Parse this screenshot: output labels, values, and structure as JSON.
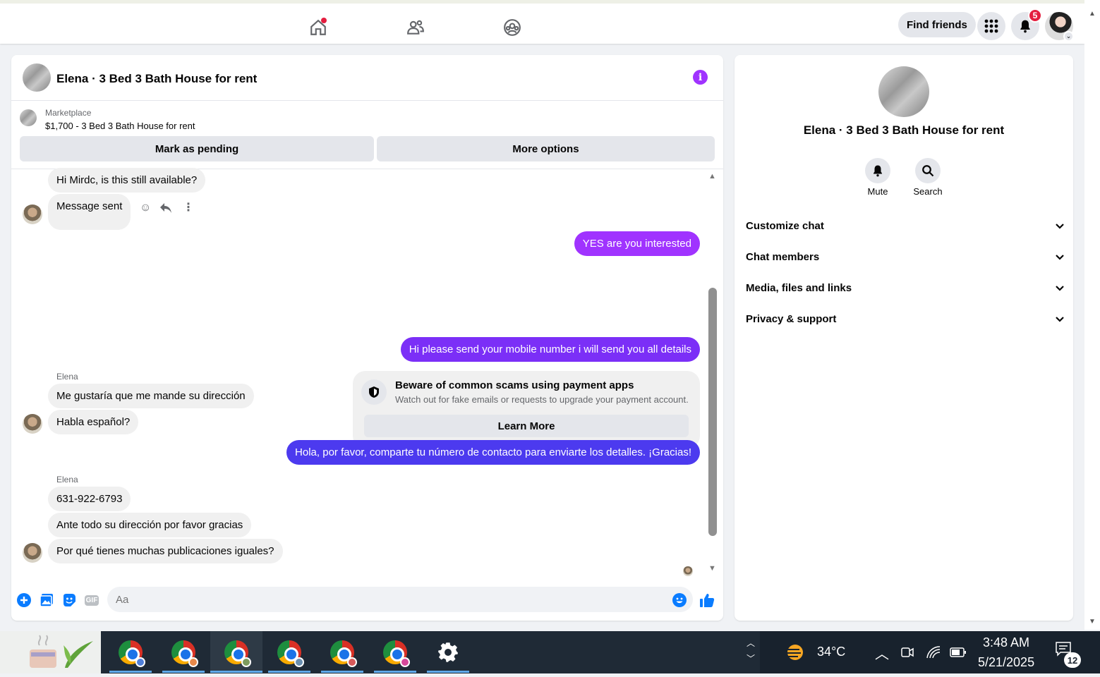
{
  "topbar": {
    "find_friends": "Find friends",
    "notification_count": "5",
    "icons": [
      "home-icon",
      "friends-icon",
      "groups-icon",
      "menu-grid-icon",
      "bell-icon"
    ]
  },
  "chat": {
    "title": "Elena · 3 Bed 3 Bath House for rent",
    "marketplace_label": "Marketplace",
    "listing": "$1,700 - 3 Bed 3 Bath House for rent",
    "mark_pending": "Mark as pending",
    "more_options": "More options",
    "messages": {
      "m1": "Hi Mirdc, is this still available?",
      "m2": "Message sent",
      "m3": "YES are you interested",
      "m4": "Hi please send your mobile number  i will send you all details",
      "sender1": "Elena",
      "m5": "Me gustaría que me mande su dirección",
      "m6": "Habla español?",
      "m7": "Hola, por favor, comparte tu número de contacto para enviarte los detalles. ¡Gracias!",
      "sender2": "Elena",
      "m8": "631-922-6793",
      "m9": "Ante todo su dirección por favor gracias",
      "m10": "Por qué tienes muchas publicaciones iguales?"
    },
    "scam_notice": {
      "title": "Beware of common scams using payment apps",
      "description": "Watch out for fake emails or requests to upgrade your payment account.",
      "button": "Learn More"
    },
    "composer": {
      "placeholder": "Aa",
      "gif_label": "GIF"
    }
  },
  "info_panel": {
    "title": "Elena · 3 Bed 3 Bath House for rent",
    "mute_label": "Mute",
    "search_label": "Search",
    "sections": [
      "Customize chat",
      "Chat members",
      "Media, files and links",
      "Privacy & support"
    ]
  },
  "taskbar": {
    "temperature": "34°C",
    "time": "3:48 AM",
    "date": "5/21/2025",
    "notification_count": "12"
  },
  "colors": {
    "accent_purple": "#a033ff",
    "bubble_gradient": [
      "#a033ff",
      "#7b2ff7",
      "#4c3aef",
      "#2f5ff0"
    ],
    "messenger_blue": "#0a7cff",
    "taskbar": "#1f2a36"
  }
}
